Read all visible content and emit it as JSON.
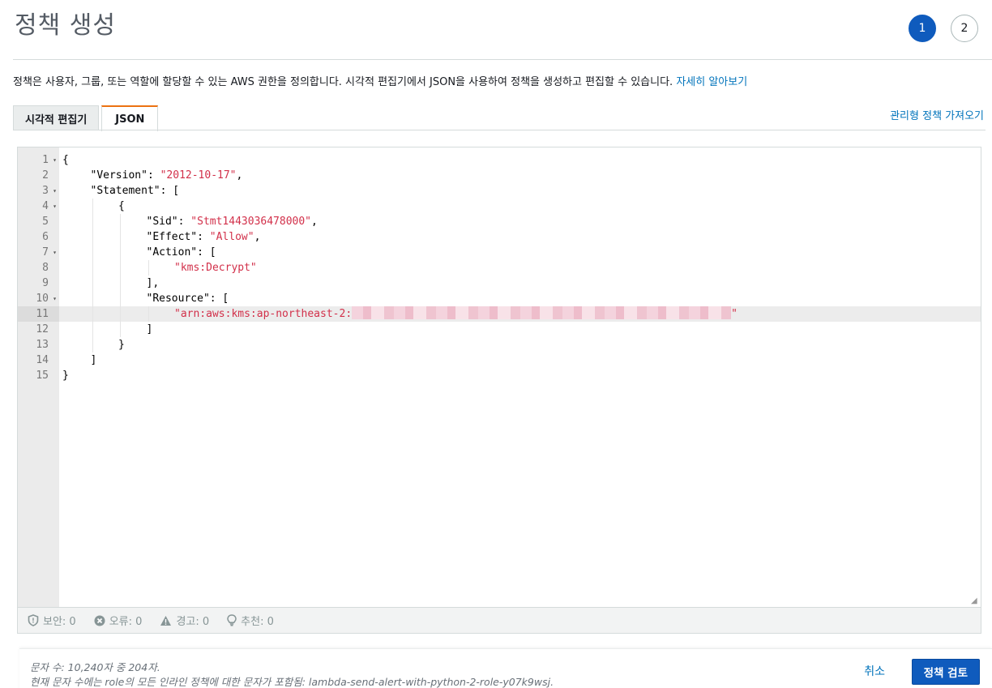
{
  "header": {
    "title": "정책 생성",
    "steps": [
      "1",
      "2"
    ],
    "active_step": 1
  },
  "description": {
    "text": "정책은 사용자, 그룹, 또는 역할에 할당할 수 있는 AWS 권한을 정의합니다. 시각적 편집기에서 JSON을 사용하여 정책을 생성하고 편집할 수 있습니다.",
    "link": "자세히 알아보기"
  },
  "tabs": [
    {
      "label": "시각적 편집기",
      "active": false
    },
    {
      "label": "JSON",
      "active": true
    }
  ],
  "import_link": "관리형 정책 가져오기",
  "editor": {
    "lines": [
      {
        "n": "1",
        "fold": true,
        "indent": 0,
        "parts": [
          [
            "p",
            "{"
          ]
        ]
      },
      {
        "n": "2",
        "fold": false,
        "indent": 1,
        "parts": [
          [
            "p",
            "\"Version\": "
          ],
          [
            "s",
            "\"2012-10-17\""
          ],
          [
            "p",
            ","
          ]
        ]
      },
      {
        "n": "3",
        "fold": true,
        "indent": 1,
        "parts": [
          [
            "p",
            "\"Statement\": ["
          ]
        ]
      },
      {
        "n": "4",
        "fold": true,
        "indent": 2,
        "parts": [
          [
            "p",
            "{"
          ]
        ]
      },
      {
        "n": "5",
        "fold": false,
        "indent": 3,
        "parts": [
          [
            "p",
            "\"Sid\": "
          ],
          [
            "s",
            "\"Stmt1443036478000\""
          ],
          [
            "p",
            ","
          ]
        ]
      },
      {
        "n": "6",
        "fold": false,
        "indent": 3,
        "parts": [
          [
            "p",
            "\"Effect\": "
          ],
          [
            "s",
            "\"Allow\""
          ],
          [
            "p",
            ","
          ]
        ]
      },
      {
        "n": "7",
        "fold": true,
        "indent": 3,
        "parts": [
          [
            "p",
            "\"Action\": ["
          ]
        ]
      },
      {
        "n": "8",
        "fold": false,
        "indent": 4,
        "parts": [
          [
            "s",
            "\"kms:Decrypt\""
          ]
        ]
      },
      {
        "n": "9",
        "fold": false,
        "indent": 3,
        "parts": [
          [
            "p",
            "],"
          ]
        ]
      },
      {
        "n": "10",
        "fold": true,
        "indent": 3,
        "parts": [
          [
            "p",
            "\"Resource\": ["
          ]
        ]
      },
      {
        "n": "11",
        "fold": false,
        "indent": 4,
        "highlight": true,
        "parts": [
          [
            "s",
            "\"arn:aws:kms:ap-northeast-2:"
          ],
          [
            "r",
            ""
          ],
          [
            "s",
            "\""
          ]
        ]
      },
      {
        "n": "12",
        "fold": false,
        "indent": 3,
        "parts": [
          [
            "p",
            "]"
          ]
        ]
      },
      {
        "n": "13",
        "fold": false,
        "indent": 2,
        "parts": [
          [
            "p",
            "}"
          ]
        ]
      },
      {
        "n": "14",
        "fold": false,
        "indent": 1,
        "parts": [
          [
            "p",
            "]"
          ]
        ]
      },
      {
        "n": "15",
        "fold": false,
        "indent": 0,
        "parts": [
          [
            "p",
            "}"
          ]
        ]
      }
    ]
  },
  "status": {
    "security": "보안: 0",
    "errors": "오류: 0",
    "warnings": "경고: 0",
    "suggestions": "추천: 0"
  },
  "footer": {
    "char_count": "문자 수: 10,240자 중 204자.",
    "char_note": "현재 문자 수에는 role의 모든 인라인 정책에 대한 문자가 포함됨: lambda-send-alert-with-python-2-role-y07k9wsj.",
    "cancel_label": "취소",
    "review_label": "정책 검토"
  }
}
